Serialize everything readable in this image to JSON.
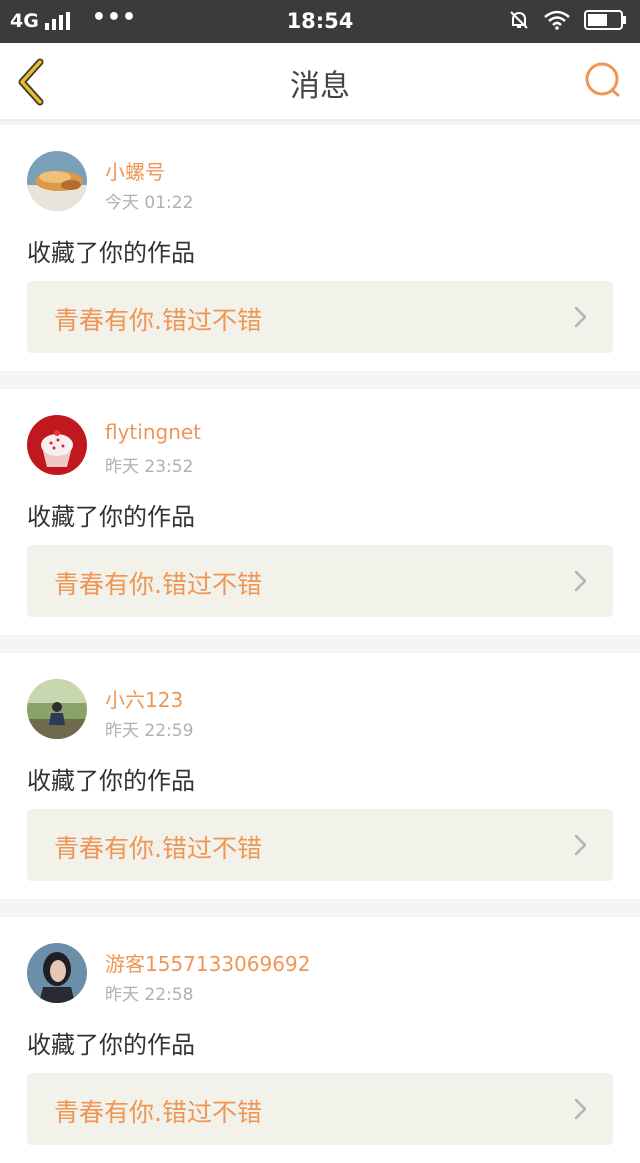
{
  "status_bar": {
    "network": "4G",
    "dots": "•••",
    "time": "18:54"
  },
  "header": {
    "title": "消息",
    "back_icon": "chevron-left-icon",
    "search_icon": "search-icon"
  },
  "messages": [
    {
      "username": "小螺号",
      "time": "今天 01:22",
      "action": "收藏了你的作品",
      "work_title": "青春有你.错过不错",
      "avatar": "avatar-food"
    },
    {
      "username": "flytingnet",
      "time": "昨天 23:52",
      "action": "收藏了你的作品",
      "work_title": "青春有你.错过不错",
      "avatar": "avatar-cupcake"
    },
    {
      "username": "小六123",
      "time": "昨天 22:59",
      "action": "收藏了你的作品",
      "work_title": "青春有你.错过不错",
      "avatar": "avatar-person-outdoor"
    },
    {
      "username": "游客1557133069692",
      "time": "昨天 22:58",
      "action": "收藏了你的作品",
      "work_title": "青春有你.错过不错",
      "avatar": "avatar-portrait"
    }
  ],
  "colors": {
    "accent": "#ef9655",
    "back_icon": "#e8c020",
    "statusbar_bg": "#3b3b3b",
    "card_link_bg": "#f2f2ea"
  }
}
